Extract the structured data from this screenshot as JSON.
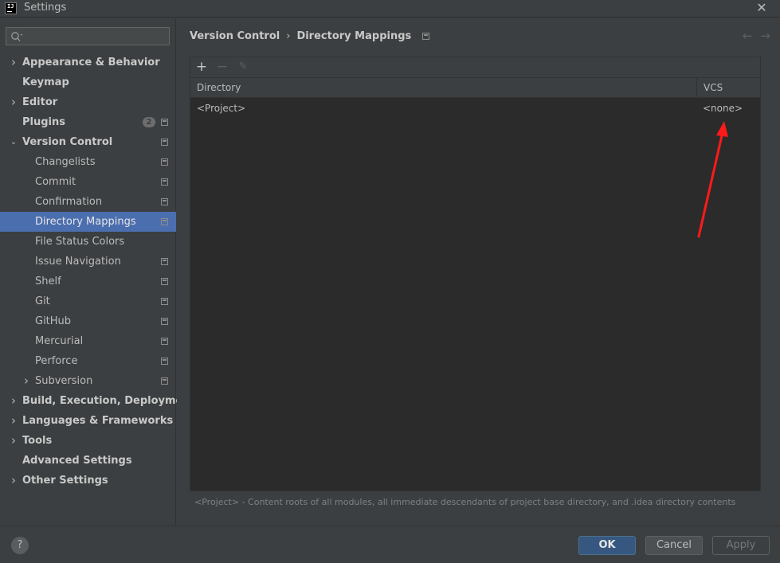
{
  "window": {
    "title": "Settings",
    "logo_text": "IJ",
    "close_glyph": "✕"
  },
  "sidebar": {
    "search": {
      "value": "",
      "placeholder": ""
    },
    "items": [
      {
        "label": "Appearance & Behavior",
        "level": 1,
        "expandable": true,
        "expanded": false
      },
      {
        "label": "Keymap",
        "level": 1,
        "expandable": false
      },
      {
        "label": "Editor",
        "level": 1,
        "expandable": true,
        "expanded": false
      },
      {
        "label": "Plugins",
        "level": 1,
        "badge": "2",
        "page_icon": true
      },
      {
        "label": "Version Control",
        "level": 1,
        "expandable": true,
        "expanded": true,
        "page_icon": true
      },
      {
        "label": "Changelists",
        "level": 2,
        "page_icon": true
      },
      {
        "label": "Commit",
        "level": 2,
        "page_icon": true
      },
      {
        "label": "Confirmation",
        "level": 2,
        "page_icon": true
      },
      {
        "label": "Directory Mappings",
        "level": 2,
        "page_icon": true,
        "selected": true
      },
      {
        "label": "File Status Colors",
        "level": 2
      },
      {
        "label": "Issue Navigation",
        "level": 2,
        "page_icon": true
      },
      {
        "label": "Shelf",
        "level": 2,
        "page_icon": true
      },
      {
        "label": "Git",
        "level": 2,
        "page_icon": true
      },
      {
        "label": "GitHub",
        "level": 2,
        "page_icon": true
      },
      {
        "label": "Mercurial",
        "level": 2,
        "page_icon": true
      },
      {
        "label": "Perforce",
        "level": 2,
        "page_icon": true
      },
      {
        "label": "Subversion",
        "level": 2,
        "expandable": true,
        "expanded": false,
        "page_icon": true
      },
      {
        "label": "Build, Execution, Deployment",
        "level": 1,
        "expandable": true,
        "expanded": false
      },
      {
        "label": "Languages & Frameworks",
        "level": 1,
        "expandable": true,
        "expanded": false
      },
      {
        "label": "Tools",
        "level": 1,
        "expandable": true,
        "expanded": false
      },
      {
        "label": "Advanced Settings",
        "level": 1
      },
      {
        "label": "Other Settings",
        "level": 1,
        "expandable": true,
        "expanded": false
      }
    ]
  },
  "main": {
    "breadcrumb": {
      "parent": "Version Control",
      "separator": "›",
      "current": "Directory Mappings"
    },
    "nav": {
      "back": "←",
      "forward": "→"
    },
    "toolbar": {
      "add": "+",
      "remove": "−",
      "edit": "✎"
    },
    "table": {
      "columns": [
        "Directory",
        "VCS"
      ],
      "rows": [
        {
          "directory": "<Project>",
          "vcs": "<none>"
        }
      ]
    },
    "hint": "<Project> - Content roots of all modules, all immediate descendants of project base directory, and .idea directory contents"
  },
  "footer": {
    "help": "?",
    "ok": "OK",
    "cancel": "Cancel",
    "apply": "Apply"
  },
  "colors": {
    "background": "#3c3f41",
    "table_background": "#2b2b2b",
    "selection": "#4b6eaf",
    "ok_button": "#365880",
    "annotation_arrow": "#ff1a1a"
  }
}
